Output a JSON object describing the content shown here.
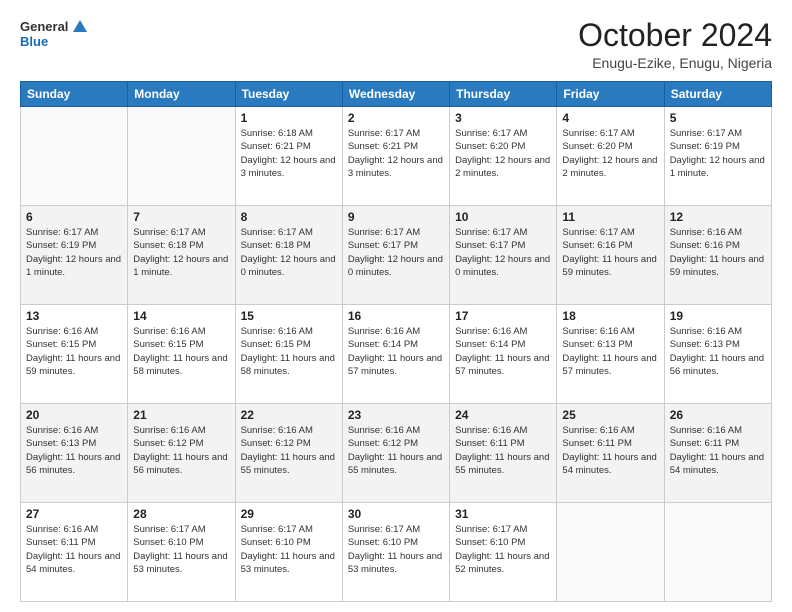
{
  "header": {
    "logo_line1": "General",
    "logo_line2": "Blue",
    "month": "October 2024",
    "location": "Enugu-Ezike, Enugu, Nigeria"
  },
  "weekdays": [
    "Sunday",
    "Monday",
    "Tuesday",
    "Wednesday",
    "Thursday",
    "Friday",
    "Saturday"
  ],
  "weeks": [
    [
      {
        "day": "",
        "info": ""
      },
      {
        "day": "",
        "info": ""
      },
      {
        "day": "1",
        "info": "Sunrise: 6:18 AM\nSunset: 6:21 PM\nDaylight: 12 hours and 3 minutes."
      },
      {
        "day": "2",
        "info": "Sunrise: 6:17 AM\nSunset: 6:21 PM\nDaylight: 12 hours and 3 minutes."
      },
      {
        "day": "3",
        "info": "Sunrise: 6:17 AM\nSunset: 6:20 PM\nDaylight: 12 hours and 2 minutes."
      },
      {
        "day": "4",
        "info": "Sunrise: 6:17 AM\nSunset: 6:20 PM\nDaylight: 12 hours and 2 minutes."
      },
      {
        "day": "5",
        "info": "Sunrise: 6:17 AM\nSunset: 6:19 PM\nDaylight: 12 hours and 1 minute."
      }
    ],
    [
      {
        "day": "6",
        "info": "Sunrise: 6:17 AM\nSunset: 6:19 PM\nDaylight: 12 hours and 1 minute."
      },
      {
        "day": "7",
        "info": "Sunrise: 6:17 AM\nSunset: 6:18 PM\nDaylight: 12 hours and 1 minute."
      },
      {
        "day": "8",
        "info": "Sunrise: 6:17 AM\nSunset: 6:18 PM\nDaylight: 12 hours and 0 minutes."
      },
      {
        "day": "9",
        "info": "Sunrise: 6:17 AM\nSunset: 6:17 PM\nDaylight: 12 hours and 0 minutes."
      },
      {
        "day": "10",
        "info": "Sunrise: 6:17 AM\nSunset: 6:17 PM\nDaylight: 12 hours and 0 minutes."
      },
      {
        "day": "11",
        "info": "Sunrise: 6:17 AM\nSunset: 6:16 PM\nDaylight: 11 hours and 59 minutes."
      },
      {
        "day": "12",
        "info": "Sunrise: 6:16 AM\nSunset: 6:16 PM\nDaylight: 11 hours and 59 minutes."
      }
    ],
    [
      {
        "day": "13",
        "info": "Sunrise: 6:16 AM\nSunset: 6:15 PM\nDaylight: 11 hours and 59 minutes."
      },
      {
        "day": "14",
        "info": "Sunrise: 6:16 AM\nSunset: 6:15 PM\nDaylight: 11 hours and 58 minutes."
      },
      {
        "day": "15",
        "info": "Sunrise: 6:16 AM\nSunset: 6:15 PM\nDaylight: 11 hours and 58 minutes."
      },
      {
        "day": "16",
        "info": "Sunrise: 6:16 AM\nSunset: 6:14 PM\nDaylight: 11 hours and 57 minutes."
      },
      {
        "day": "17",
        "info": "Sunrise: 6:16 AM\nSunset: 6:14 PM\nDaylight: 11 hours and 57 minutes."
      },
      {
        "day": "18",
        "info": "Sunrise: 6:16 AM\nSunset: 6:13 PM\nDaylight: 11 hours and 57 minutes."
      },
      {
        "day": "19",
        "info": "Sunrise: 6:16 AM\nSunset: 6:13 PM\nDaylight: 11 hours and 56 minutes."
      }
    ],
    [
      {
        "day": "20",
        "info": "Sunrise: 6:16 AM\nSunset: 6:13 PM\nDaylight: 11 hours and 56 minutes."
      },
      {
        "day": "21",
        "info": "Sunrise: 6:16 AM\nSunset: 6:12 PM\nDaylight: 11 hours and 56 minutes."
      },
      {
        "day": "22",
        "info": "Sunrise: 6:16 AM\nSunset: 6:12 PM\nDaylight: 11 hours and 55 minutes."
      },
      {
        "day": "23",
        "info": "Sunrise: 6:16 AM\nSunset: 6:12 PM\nDaylight: 11 hours and 55 minutes."
      },
      {
        "day": "24",
        "info": "Sunrise: 6:16 AM\nSunset: 6:11 PM\nDaylight: 11 hours and 55 minutes."
      },
      {
        "day": "25",
        "info": "Sunrise: 6:16 AM\nSunset: 6:11 PM\nDaylight: 11 hours and 54 minutes."
      },
      {
        "day": "26",
        "info": "Sunrise: 6:16 AM\nSunset: 6:11 PM\nDaylight: 11 hours and 54 minutes."
      }
    ],
    [
      {
        "day": "27",
        "info": "Sunrise: 6:16 AM\nSunset: 6:11 PM\nDaylight: 11 hours and 54 minutes."
      },
      {
        "day": "28",
        "info": "Sunrise: 6:17 AM\nSunset: 6:10 PM\nDaylight: 11 hours and 53 minutes."
      },
      {
        "day": "29",
        "info": "Sunrise: 6:17 AM\nSunset: 6:10 PM\nDaylight: 11 hours and 53 minutes."
      },
      {
        "day": "30",
        "info": "Sunrise: 6:17 AM\nSunset: 6:10 PM\nDaylight: 11 hours and 53 minutes."
      },
      {
        "day": "31",
        "info": "Sunrise: 6:17 AM\nSunset: 6:10 PM\nDaylight: 11 hours and 52 minutes."
      },
      {
        "day": "",
        "info": ""
      },
      {
        "day": "",
        "info": ""
      }
    ]
  ]
}
